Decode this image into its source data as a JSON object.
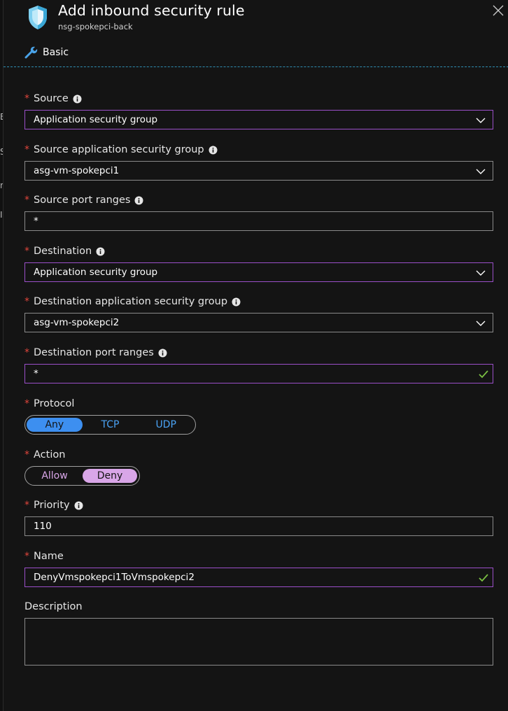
{
  "header": {
    "title": "Add inbound security rule",
    "subtitle": "nsg-spokepci-back",
    "tab_basic": "Basic"
  },
  "left_strip": [
    "E",
    "S",
    "n",
    "I"
  ],
  "form": {
    "source": {
      "label": "Source",
      "value": "Application security group"
    },
    "source_asg": {
      "label": "Source application security group",
      "value": "asg-vm-spokepci1"
    },
    "source_port_ranges": {
      "label": "Source port ranges",
      "value": "*"
    },
    "destination": {
      "label": "Destination",
      "value": "Application security group"
    },
    "destination_asg": {
      "label": "Destination application security group",
      "value": "asg-vm-spokepci2"
    },
    "destination_port_ranges": {
      "label": "Destination port ranges",
      "value": "*"
    },
    "protocol": {
      "label": "Protocol",
      "options": [
        "Any",
        "TCP",
        "UDP"
      ],
      "selected": "Any"
    },
    "action": {
      "label": "Action",
      "options": [
        "Allow",
        "Deny"
      ],
      "selected": "Deny"
    },
    "priority": {
      "label": "Priority",
      "value": "110"
    },
    "name": {
      "label": "Name",
      "value": "DenyVmspokepci1ToVmspokepci2"
    },
    "description": {
      "label": "Description",
      "value": ""
    }
  },
  "colors": {
    "background": "#141414",
    "required_asterisk": "#e0463c",
    "focus_border": "#9b4fc9",
    "protocol_selected": "#3d8ff0",
    "action_selected": "#d9a6e8",
    "valid_check": "#7bc043",
    "divider": "#2f8fb3"
  }
}
